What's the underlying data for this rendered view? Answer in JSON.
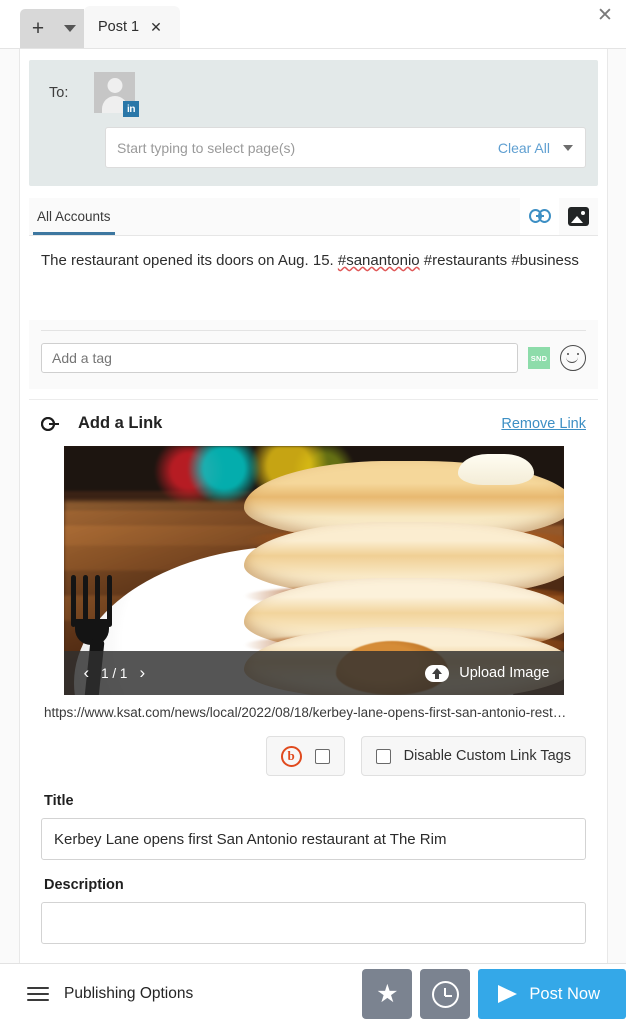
{
  "window": {
    "close_label": "✕"
  },
  "tabbar": {
    "new_tab_label": "+",
    "dropdown_icon": "chevron-down",
    "tabs": [
      {
        "label": "Post 1",
        "close_label": "✕"
      }
    ]
  },
  "recipients": {
    "to_label": "To:",
    "avatar_network": "linkedin",
    "avatar_badge": "in",
    "select_placeholder": "Start typing to select page(s)",
    "clear_all_label": "Clear All"
  },
  "accounts": {
    "tab_label": "All Accounts",
    "mode_tabs": [
      {
        "name": "link",
        "icon": "link-icon",
        "active": true
      },
      {
        "name": "image",
        "icon": "image-icon",
        "active": false
      }
    ]
  },
  "compose": {
    "text_before": "The restaurant opened its doors on Aug. 15. ",
    "misspelled": "#sanantonio",
    "text_after": " #restaurants #business",
    "full_text": "The restaurant opened its doors on Aug. 15. #sanantonio #restaurants #business"
  },
  "tagbar": {
    "tag_placeholder": "Add a tag",
    "snd_badge": "SND",
    "emoji_icon": "smiley-icon"
  },
  "link_card": {
    "title": "Add a Link",
    "remove_label": "Remove Link",
    "url": "https://www.ksat.com/news/local/2022/08/18/kerbey-lane-opens-first-san-antonio-rest…",
    "carousel": {
      "prev": "‹",
      "next": "›",
      "counter": "1 / 1",
      "upload_label": "Upload Image"
    },
    "options": {
      "bitly_label": "b",
      "bitly_checked": false,
      "disable_tags_label": "Disable Custom Link Tags",
      "disable_tags_checked": false
    },
    "fields": {
      "title_label": "Title",
      "title_value": "Kerbey Lane opens first San Antonio restaurant at The Rim",
      "description_label": "Description",
      "description_value": ""
    }
  },
  "bottombar": {
    "menu_icon": "hamburger-icon",
    "publishing_options_label": "Publishing Options",
    "favorite_icon": "star-icon",
    "schedule_icon": "clock-icon",
    "post_label": "Post Now"
  },
  "colors": {
    "accent_blue": "#34a8e8",
    "link_blue": "#3d8fc4",
    "tab_underline": "#3d77a0",
    "snd_green": "#8ddcaa",
    "bitly_orange": "#e04a1e",
    "button_gray": "#7b8390",
    "to_panel": "#e3e9e9"
  }
}
